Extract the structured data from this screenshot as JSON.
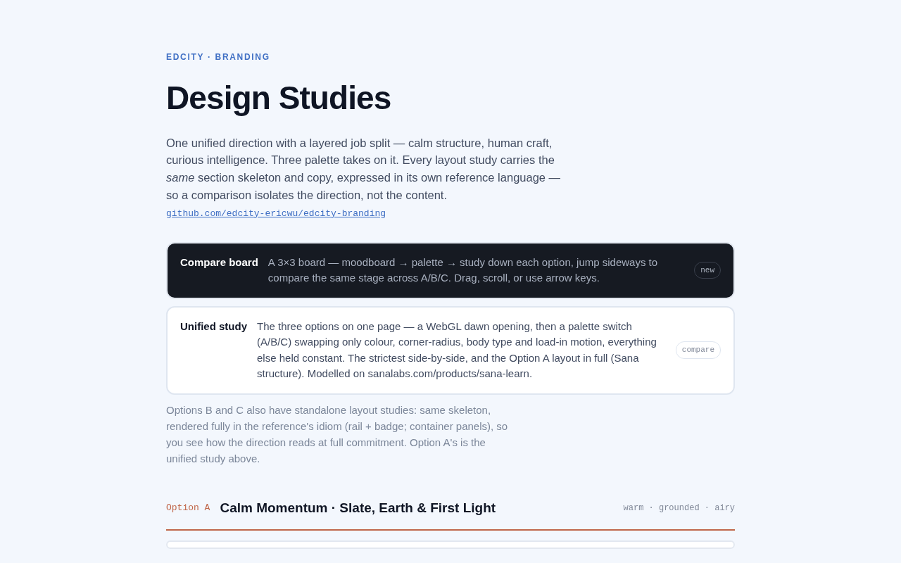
{
  "eyebrow": "EDCITY · BRANDING",
  "title": "Design Studies",
  "intro": "One unified direction with a layered job split — calm structure, human craft, curious intelligence. Three palette takes on it. Every layout study carries the *same* section skeleton and copy, expressed in its own reference language — so a comparison isolates the direction, not the content.",
  "repo_link": "github.com/edcity-ericwu/edcity-branding",
  "studies": [
    {
      "kind": "dark",
      "title": "Compare board",
      "description": "A 3×3 board — moodboard → palette → study down each option, jump sideways to compare the same stage across A/B/C. Drag, scroll, or use arrow keys.",
      "tag": "new"
    },
    {
      "kind": "light",
      "title": "Unified study",
      "description": "The three options on one page — a WebGL dawn opening, then a palette switch (A/B/C) swapping only colour, corner-radius, body type and load-in motion, everything else held constant. The strictest side-by-side, and the Option A layout in full (Sana structure). Modelled on sanalabs.com/products/sana-learn.",
      "tag": "compare"
    }
  ],
  "note": "Options B and C also have standalone layout studies: same skeleton, rendered fully in the reference's idiom (rail + badge; container panels), so you see how the direction reads at full commitment. Option A's is the unified study above.",
  "option": {
    "label": "Option A",
    "title": "Calm Momentum · Slate, Earth & First Light",
    "keywords": "warm · grounded · airy",
    "color": "#c0664a"
  }
}
